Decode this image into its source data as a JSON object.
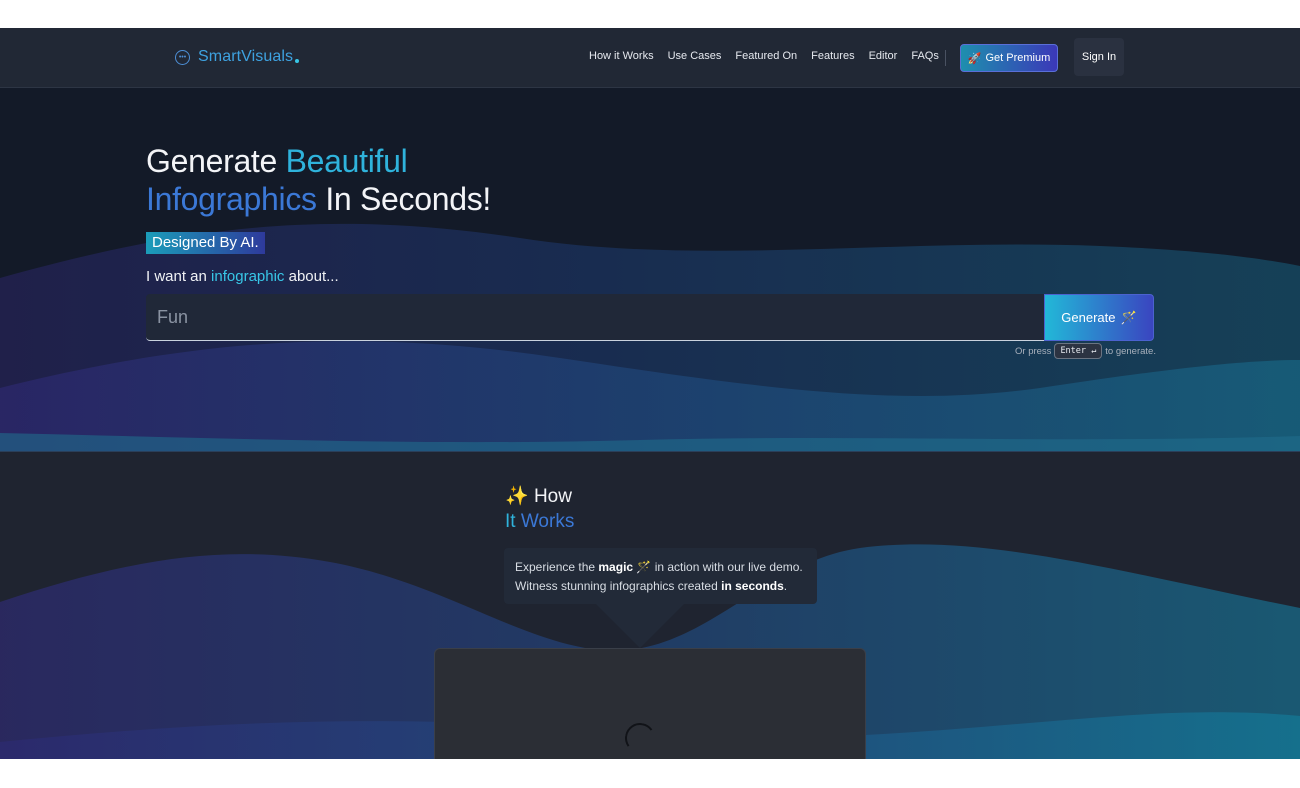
{
  "nav": {
    "brand_name": "SmartVisuals",
    "links": [
      "How it Works",
      "Use Cases",
      "Featured On",
      "Features",
      "Editor",
      "FAQs"
    ],
    "premium_label": "Get Premium",
    "signin_label": "Sign In"
  },
  "hero": {
    "headline_part1": "Generate ",
    "headline_part2": "Beautiful",
    "headline_part3": "Infographics",
    "headline_part4": " In Seconds!",
    "badge": "Designed By AI.",
    "subline_prefix": "I want an ",
    "subline_highlight": "infographic",
    "subline_suffix": " about...",
    "input_placeholder": "Fun",
    "generate_label": "Generate",
    "hint_prefix": "Or press",
    "hint_key": "Enter ↵",
    "hint_suffix": "to generate."
  },
  "how": {
    "title_emoji": "✨",
    "title_word1": "How",
    "title_word2": "It",
    "title_word3": "Works",
    "callout_t1": "Experience the ",
    "callout_b1": "magic",
    "callout_t2": " 🪄 in action with our live demo.",
    "callout_t3": "Witness stunning infographics created ",
    "callout_b2": "in seconds",
    "callout_t4": "."
  },
  "colors": {
    "accent_cyan": "#2fb3dc",
    "accent_blue": "#3b78d6",
    "background_dark": "#131a28"
  }
}
